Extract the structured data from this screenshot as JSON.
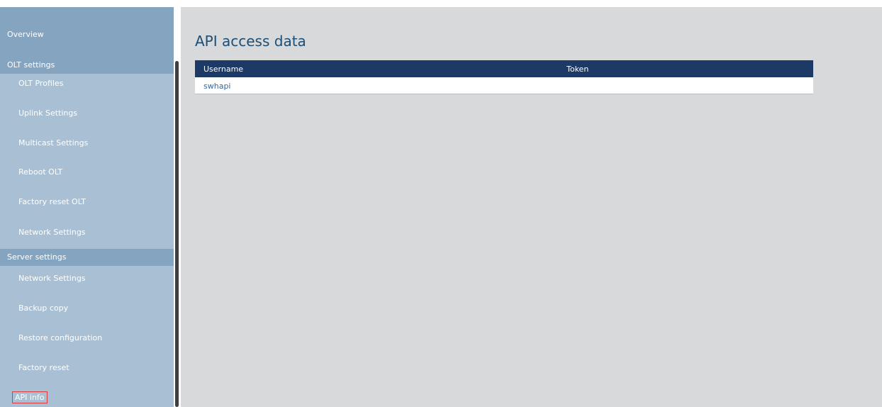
{
  "sidebar": {
    "overview": "Overview",
    "olt_section": "OLT settings",
    "olt_items": [
      "OLT Profiles",
      "Uplink Settings",
      "Multicast Settings",
      "Reboot OLT",
      "Factory reset OLT",
      "Network Settings"
    ],
    "server_section": "Server settings",
    "server_items": [
      "Network Settings",
      "Backup copy",
      "Restore configuration",
      "Factory reset",
      "API info"
    ]
  },
  "main": {
    "title": "API access data",
    "table": {
      "columns": [
        "Username",
        "Token"
      ],
      "rows": [
        {
          "username": "swhapi",
          "token": ""
        }
      ]
    }
  },
  "colors": {
    "sidebar_bg": "#a9c0d4",
    "section_bg": "#84a4bf",
    "table_header": "#1d3a66",
    "title": "#1d4e78",
    "selected_border": "#e03a3a"
  }
}
